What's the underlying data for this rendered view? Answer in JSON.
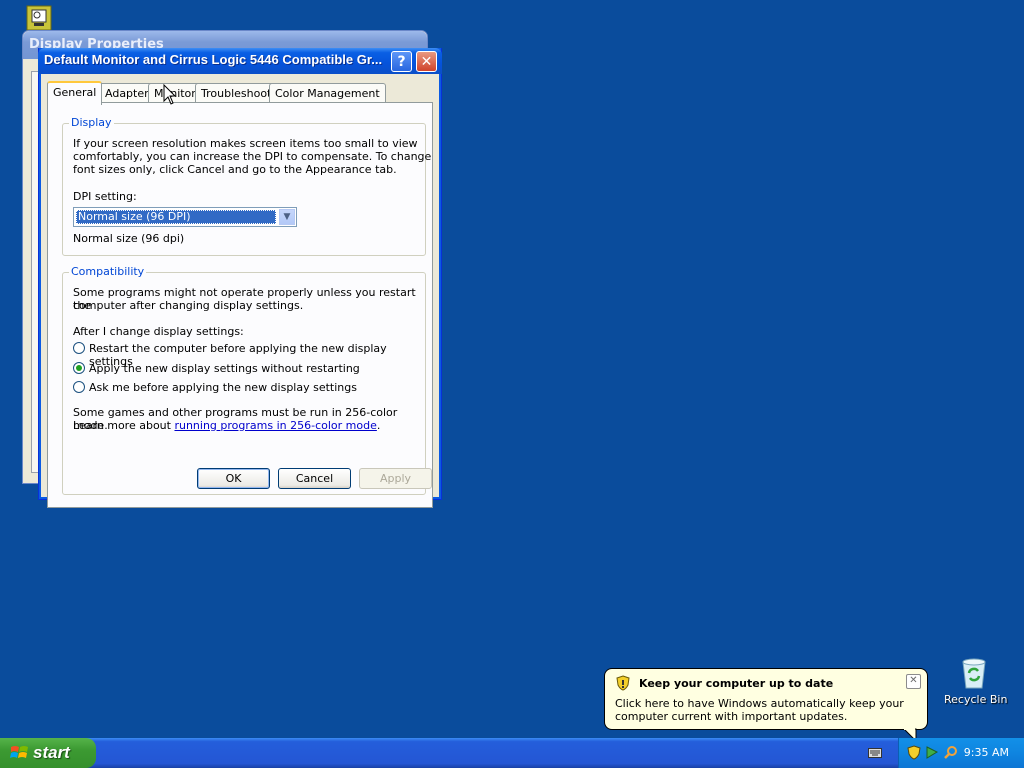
{
  "desktop": {
    "recycle_bin_label": "Recycle Bin"
  },
  "background_window": {
    "title": "Display Properties"
  },
  "dialog": {
    "title": "Default Monitor and Cirrus Logic 5446 Compatible Gr...",
    "tabs": [
      {
        "label": "General",
        "active": true
      },
      {
        "label": "Adapter",
        "active": false
      },
      {
        "label": "Monitor",
        "active": false
      },
      {
        "label": "Troubleshoot",
        "active": false
      },
      {
        "label": "Color Management",
        "active": false
      }
    ],
    "display_group": {
      "title": "Display",
      "description_lines": [
        "If your screen resolution makes screen items too small to view",
        "comfortably, you can increase the DPI to compensate.  To change",
        "font sizes only, click Cancel and go to the Appearance tab."
      ],
      "dpi_label": "DPI setting:",
      "dpi_selected": "Normal size (96 DPI)",
      "dpi_note": "Normal size (96 dpi)"
    },
    "compat_group": {
      "title": "Compatibility",
      "description_lines": [
        "Some programs might not operate properly unless you restart the",
        "computer after changing display settings."
      ],
      "after_label": "After I change display settings:",
      "options": [
        {
          "label": "Restart the computer before applying the new display settings",
          "checked": false
        },
        {
          "label": "Apply the new display settings without restarting",
          "checked": true
        },
        {
          "label": "Ask me before applying the new display settings",
          "checked": false
        }
      ],
      "note_line1": "Some games and other programs must be run in 256-color mode.",
      "note_line2_prefix": "Learn more about ",
      "note_link": "running programs in 256-color mode",
      "note_line2_suffix": "."
    },
    "buttons": {
      "ok": "OK",
      "cancel": "Cancel",
      "apply": "Apply"
    }
  },
  "balloon": {
    "title": "Keep your computer up to date",
    "body": "Click here to have Windows automatically keep your computer current with important updates."
  },
  "taskbar": {
    "start_label": "start",
    "clock": "9:35 AM"
  }
}
